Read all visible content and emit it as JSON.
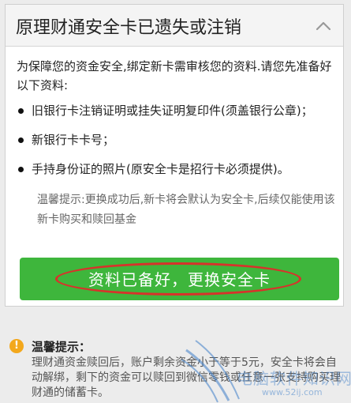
{
  "panel": {
    "title": "原理财通安全卡已遗失或注销",
    "intro": "为保障您的资金安全,绑定新卡需审核您的资料.请您先准备好以下资料:",
    "requirements": [
      "旧银行卡注销证明或挂失证明复印件(须盖银行公章)；",
      "新银行卡卡号；",
      "手持身份证的照片(原安全卡是招行卡必须提供)。"
    ],
    "tip": "温馨提示:更换成功后,新卡将会默认为安全卡,后续仅能使用该新卡购买和赎回基金",
    "button_label": "资料已备好，更换安全卡"
  },
  "notice": {
    "title": "温馨提示：",
    "body": "理财通资金赎回后，账户剩余资金小于等于5元，安全卡将会自动解绑，剩下的资金可以赎回到微信零钱或任意一张支持购买理财通的储蓄卡。"
  },
  "watermark": {
    "text": "电脑软件知识网",
    "url": "www.52ij.com"
  },
  "colors": {
    "button": "#3eb63c",
    "highlight_ring": "#d8322b",
    "info_icon": "#f3a81c"
  },
  "icons": [
    "chevron-up-icon",
    "info-icon"
  ]
}
